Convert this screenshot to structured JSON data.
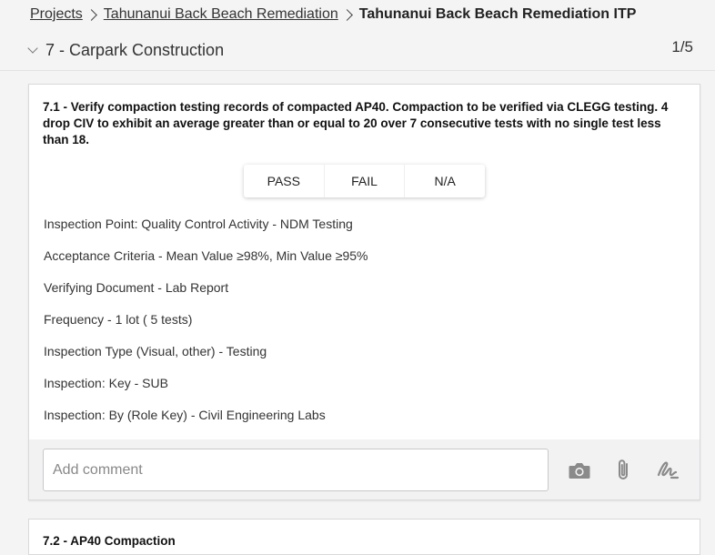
{
  "breadcrumb": {
    "items": [
      "Projects",
      "Tahunanui Back Beach Remediation"
    ],
    "current": "Tahunanui Back Beach Remediation ITP"
  },
  "section": {
    "title": "7 - Carpark Construction",
    "count": "1/5"
  },
  "item": {
    "question": "7.1 - Verify compaction testing records of compacted AP40. Compaction to be verified via CLEGG testing. 4 drop CIV to exhibit an average greater than or equal to 20 over 7 consecutive tests with no single test less than 18.",
    "options": [
      "PASS",
      "FAIL",
      "N/A"
    ],
    "details": [
      "Inspection Point: Quality Control Activity - NDM Testing",
      "Acceptance Criteria - Mean Value ≥98%, Min Value ≥95%",
      "Verifying Document - Lab Report",
      "Frequency - 1 lot ( 5 tests)",
      "Inspection Type (Visual, other) - Testing",
      "Inspection: Key - SUB",
      "Inspection: By (Role Key) - Civil Engineering Labs"
    ],
    "comment": {
      "placeholder": "Add comment",
      "value": ""
    },
    "icons": [
      "camera-icon",
      "paperclip-icon",
      "signature-icon"
    ]
  },
  "next_item": {
    "title": "7.2 - AP40 Compaction"
  },
  "colors": {
    "background": "#f4f4f5",
    "card": "#ffffff",
    "comment_bar": "#f2f2f2",
    "icon": "#8a8a8a"
  }
}
